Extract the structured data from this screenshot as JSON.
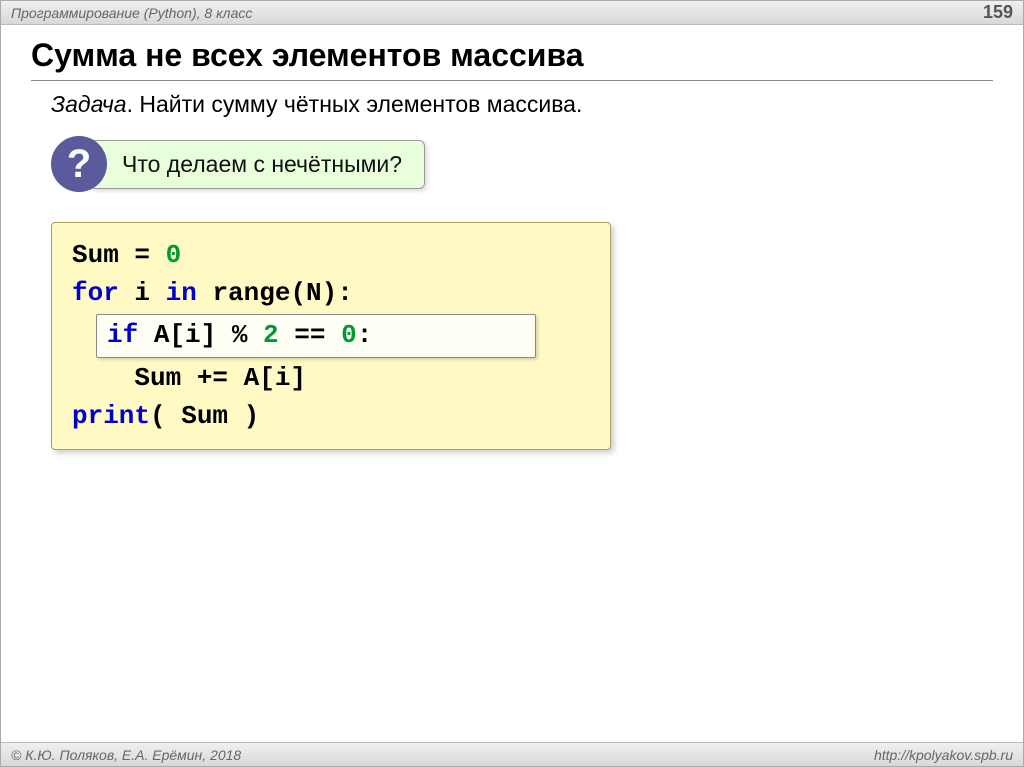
{
  "header": {
    "left": "Программирование (Python), 8 класс",
    "page": "159"
  },
  "title": "Сумма не всех элементов массива",
  "task": {
    "label": "Задача",
    "text": ". Найти сумму чётных элементов массива."
  },
  "question": {
    "mark": "?",
    "text": "Что делаем с нечётными?"
  },
  "code": {
    "l1a": "Sum = ",
    "l1b": "0",
    "l2a": "for",
    "l2b": " i ",
    "l2c": "in",
    "l2d": " range(N):",
    "l3a": "if",
    "l3b": " A[i] % ",
    "l3c": "2",
    "l3d": " == ",
    "l3e": "0",
    "l3f": ":",
    "l4": "    Sum += A[i]",
    "l5a": "print",
    "l5b": "( Sum )"
  },
  "footer": {
    "left": "© К.Ю. Поляков, Е.А. Ерёмин, 2018",
    "right": "http://kpolyakov.spb.ru"
  }
}
